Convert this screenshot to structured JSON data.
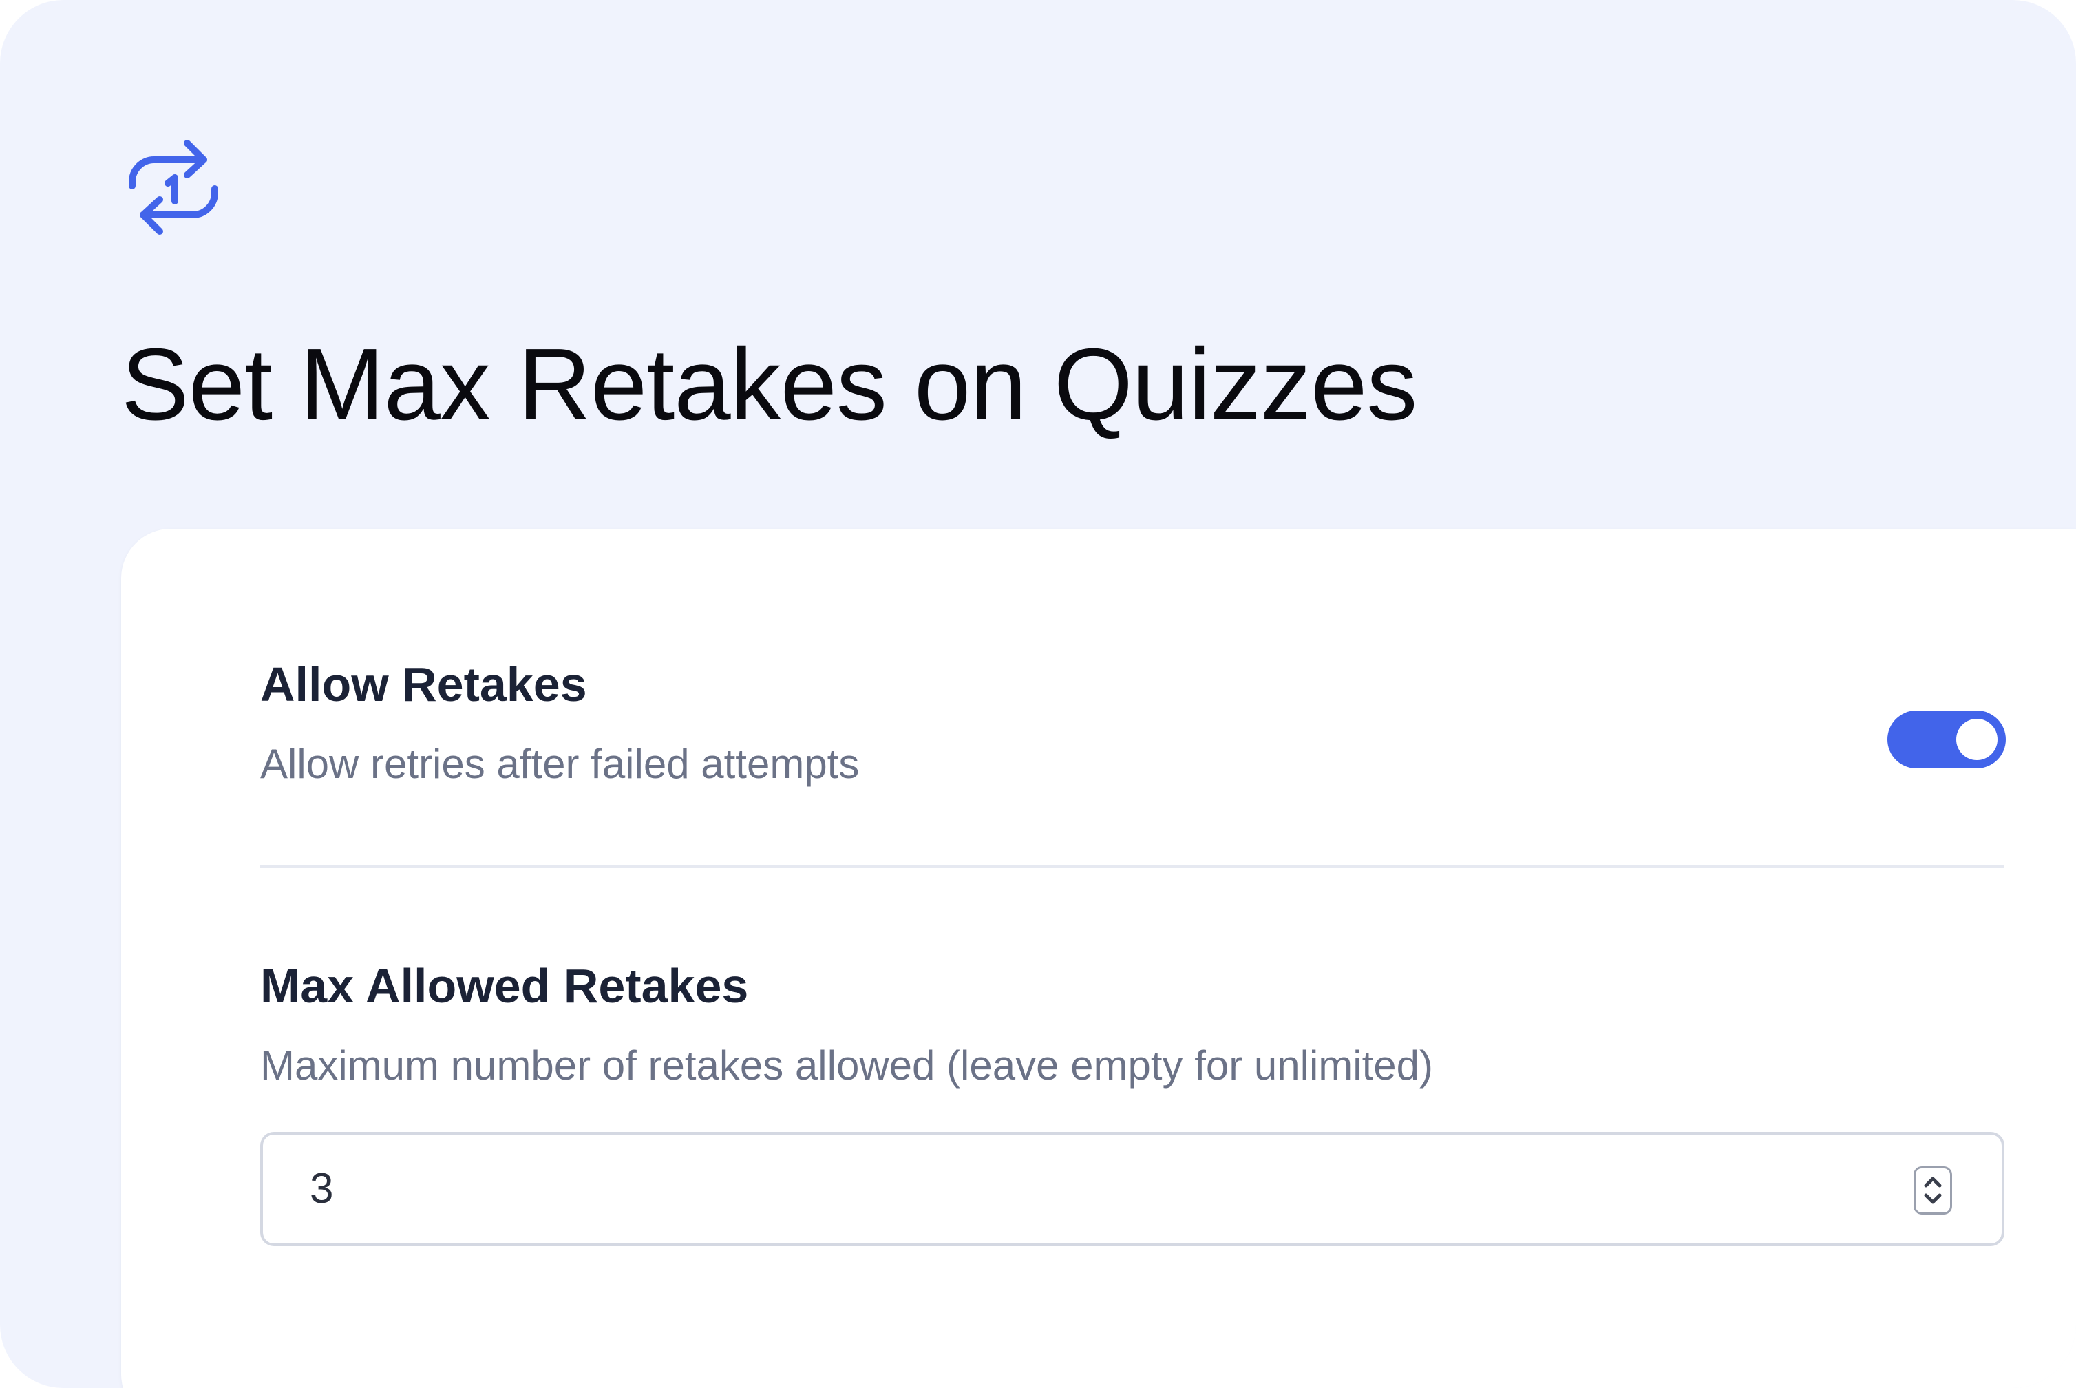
{
  "page": {
    "title": "Set Max Retakes on Quizzes",
    "icon": "repeat-once-icon"
  },
  "settings": {
    "allow_retakes": {
      "label": "Allow Retakes",
      "description": "Allow retries after failed attempts",
      "enabled": true
    },
    "max_allowed_retakes": {
      "label": "Max Allowed Retakes",
      "description": "Maximum number of retakes allowed (leave empty for unlimited)",
      "value": "3"
    }
  },
  "colors": {
    "accent": "#4264ea",
    "background": "#f0f3fd",
    "card": "#ffffff",
    "title_text": "#0a0a0f",
    "label_text": "#1b2236",
    "description_text": "#6b7287"
  }
}
